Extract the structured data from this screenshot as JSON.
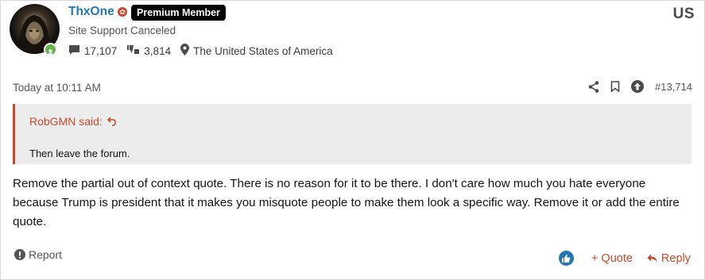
{
  "user": {
    "name": "ThxOne",
    "badge": "Premium Member",
    "title": "Site Support Canceled",
    "country_code": "US",
    "messages": "17,107",
    "reactions": "3,814",
    "location": "The United States of America"
  },
  "post": {
    "date": "Today at 10:11 AM",
    "number": "#13,714",
    "quote_author": "RobGMN said:",
    "quote_text": "Then leave the forum.",
    "body": "Remove the partial out of context quote. There is no reason for it to be there. I don't care how much you hate everyone because Trump is president that it makes you misquote people to make them look a specific way. Remove it or add the entire quote."
  },
  "footer": {
    "report": "Report",
    "quote": "+ Quote",
    "reply": "Reply"
  },
  "colors": {
    "accent": "#c84a2e",
    "username": "#2577b1",
    "online": "#63b44a",
    "quote_bg": "#ececec"
  },
  "icons": {
    "staff": "staff-icon",
    "messages": "speech-bubble-icon",
    "reactions": "thumbs-up-down-icon",
    "location": "map-pin-icon",
    "share": "share-icon",
    "bookmark": "bookmark-icon",
    "upvote": "arrow-up-circle-icon",
    "reply_quote": "reply-arrow-icon",
    "report": "exclamation-circle-icon",
    "like": "thumbs-up-icon"
  }
}
